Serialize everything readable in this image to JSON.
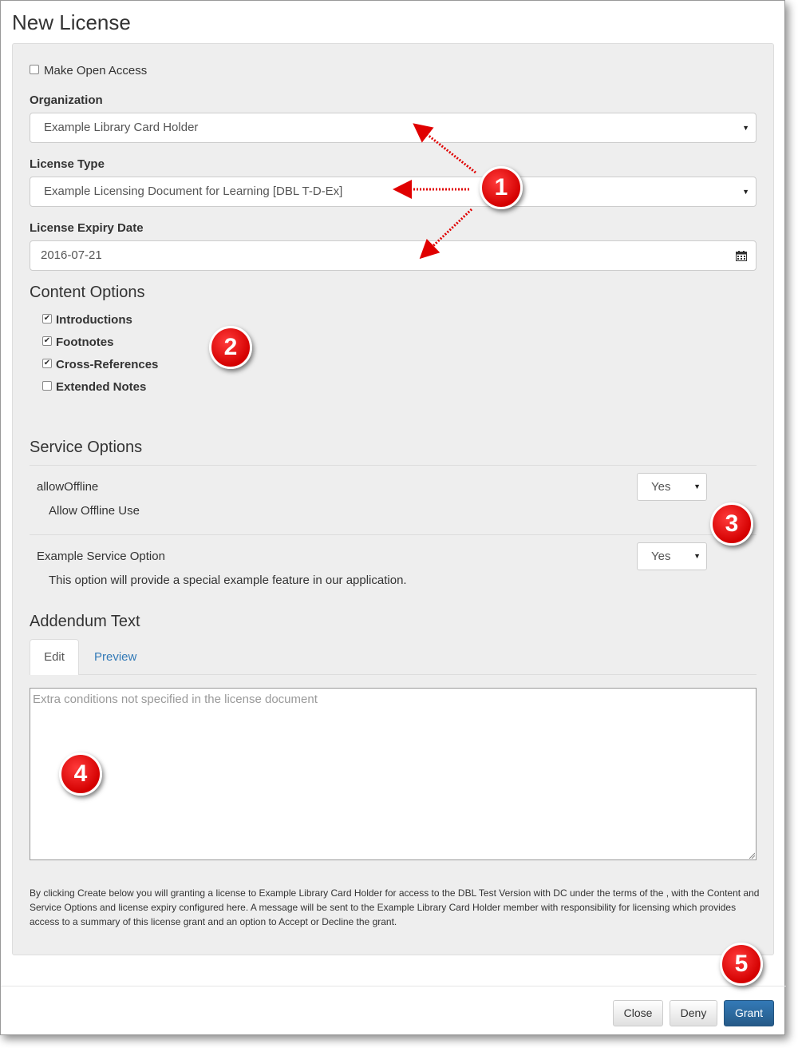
{
  "modal": {
    "title": "New License"
  },
  "open_access": {
    "label": "Make Open Access",
    "checked": false
  },
  "organization": {
    "label": "Organization",
    "value": "Example Library Card Holder"
  },
  "license_type": {
    "label": "License Type",
    "value": "Example Licensing Document for Learning [DBL T-D-Ex]"
  },
  "expiry": {
    "label": "License Expiry Date",
    "value": "2016-07-21"
  },
  "content_options": {
    "heading": "Content Options",
    "items": [
      {
        "label": "Introductions",
        "checked": true
      },
      {
        "label": "Footnotes",
        "checked": true
      },
      {
        "label": "Cross-References",
        "checked": true
      },
      {
        "label": "Extended Notes",
        "checked": false
      }
    ]
  },
  "service_options": {
    "heading": "Service Options",
    "items": [
      {
        "name": "allowOffline",
        "description": "Allow Offline Use",
        "value": "Yes"
      },
      {
        "name": "Example Service Option",
        "description": "This option will provide a special example feature in our application.",
        "value": "Yes"
      }
    ]
  },
  "addendum": {
    "heading": "Addendum Text",
    "tabs": [
      "Edit",
      "Preview"
    ],
    "active_tab": "Edit",
    "placeholder": "Extra conditions not specified in the license document",
    "value": ""
  },
  "notice": "By clicking Create below you will granting a license to Example Library Card Holder for access to the DBL Test Version with DC under the terms of the , with the Content and Service Options and license expiry configured here. A message will be sent to the Example Library Card Holder member with responsibility for licensing which provides access to a summary of this license grant and an option to Accept or Decline the grant.",
  "buttons": {
    "close": "Close",
    "deny": "Deny",
    "grant": "Grant"
  },
  "callouts": [
    "1",
    "2",
    "3",
    "4",
    "5"
  ],
  "colors": {
    "callout": "#e00000",
    "primary": "#337ab7",
    "link": "#337ab7"
  },
  "icons": {
    "calendar": "calendar-icon",
    "caret": "caret-down-icon"
  }
}
